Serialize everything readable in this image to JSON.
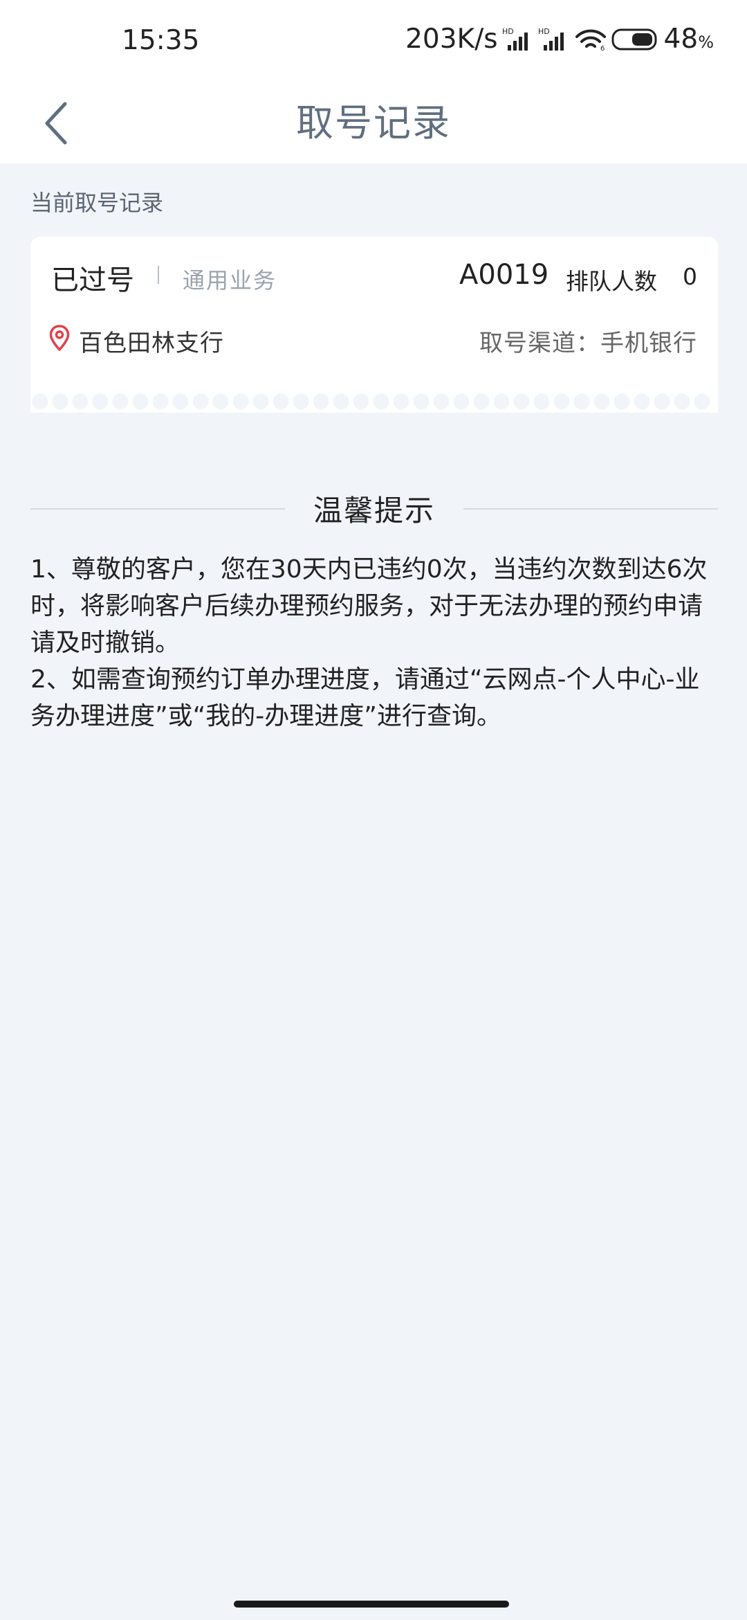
{
  "status_bar": {
    "time": "15:35",
    "net_speed": "203K/s",
    "battery_level": "48",
    "battery_unit": "%"
  },
  "header": {
    "title": "取号记录"
  },
  "section": {
    "label": "当前取号记录"
  },
  "ticket": {
    "status": "已过号",
    "service": "通用业务",
    "number": "A0019",
    "queue_label": "排队人数",
    "queue_count": "0",
    "branch": "百色田林支行",
    "channel": "取号渠道：手机银行"
  },
  "tips": {
    "title": "温馨提示",
    "items": [
      "1、尊敬的客户，您在30天内已违约0次，当违约次数到达6次时，将影响客户后续办理预约服务，对于无法办理的预约申请请及时撤销。",
      "2、如需查询预约订单办理进度，请通过“云网点-个人中心-业务办理进度”或“我的-办理进度”进行查询。"
    ]
  },
  "colors": {
    "background": "#f1f4f9",
    "title": "#5f6f80",
    "location_icon": "#e0424b"
  }
}
